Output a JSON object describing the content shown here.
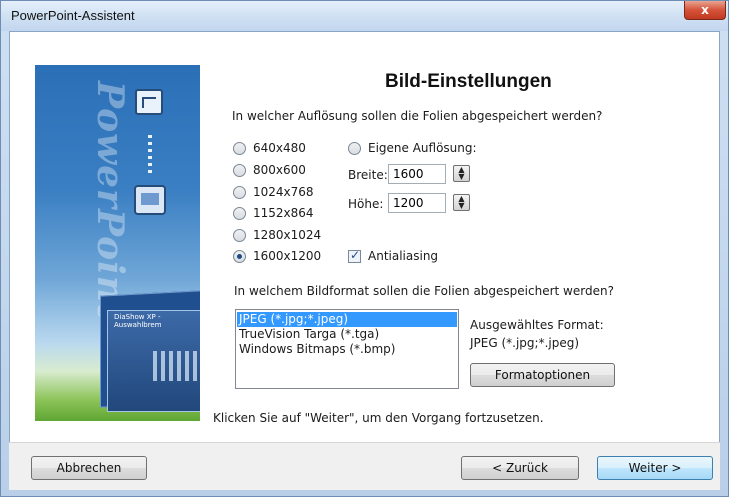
{
  "window": {
    "title": "PowerPoint-Assistent",
    "close_label": "x"
  },
  "banner": {
    "word": "PowerPoint",
    "thumb_title": "DiaShow XP - Auswahlbrem"
  },
  "page": {
    "heading": "Bild-Einstellungen",
    "resolution_question": "In welcher Auflösung sollen die Folien abgespeichert werden?",
    "resolutions": [
      {
        "label": "640x480",
        "checked": false
      },
      {
        "label": "800x600",
        "checked": false
      },
      {
        "label": "1024x768",
        "checked": false
      },
      {
        "label": "1152x864",
        "checked": false
      },
      {
        "label": "1280x1024",
        "checked": false
      },
      {
        "label": "1600x1200",
        "checked": true
      }
    ],
    "custom_resolution_label": "Eigene Auflösung:",
    "width_label": "Breite:",
    "width_value": "1600",
    "height_label": "Höhe:",
    "height_value": "1200",
    "antialiasing_label": "Antialiasing",
    "antialiasing_checked": true,
    "format_question": "In welchem Bildformat sollen die Folien abgespeichert werden?",
    "formats": [
      {
        "label": "JPEG (*.jpg;*.jpeg)",
        "selected": true
      },
      {
        "label": "TrueVision Targa (*.tga)",
        "selected": false
      },
      {
        "label": "Windows Bitmaps (*.bmp)",
        "selected": false
      }
    ],
    "selected_format_caption": "Ausgewähltes Format:",
    "selected_format_value": "JPEG (*.jpg;*.jpeg)",
    "format_options_button": "Formatoptionen",
    "hint": "Klicken Sie auf \"Weiter\", um den Vorgang fortzusetzen."
  },
  "footer": {
    "cancel_label": "Abbrechen",
    "back_label": "< Zurück",
    "next_label": "Weiter >"
  }
}
